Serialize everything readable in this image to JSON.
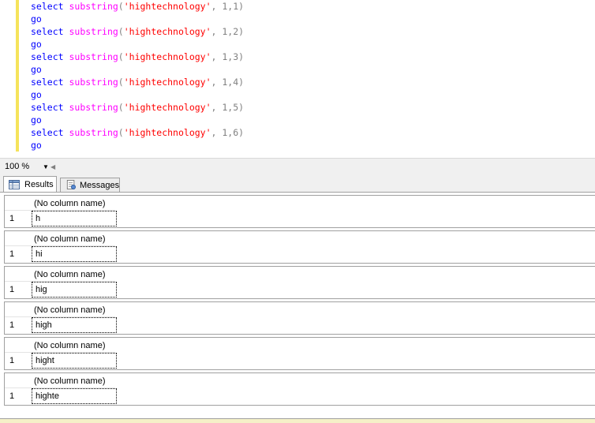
{
  "editor": {
    "lines": [
      {
        "kw": "select",
        "fn": "substring",
        "open": "(",
        "str": "'hightechnology'",
        "args": ", 1,1",
        "close": ")"
      },
      {
        "go": "go"
      },
      {
        "kw": "select",
        "fn": "substring",
        "open": "(",
        "str": "'hightechnology'",
        "args": ", 1,2",
        "close": ")"
      },
      {
        "go": "go"
      },
      {
        "kw": "select",
        "fn": "substring",
        "open": "(",
        "str": "'hightechnology'",
        "args": ", 1,3",
        "close": ")"
      },
      {
        "go": "go"
      },
      {
        "kw": "select",
        "fn": "substring",
        "open": "(",
        "str": "'hightechnology'",
        "args": ", 1,4",
        "close": ")"
      },
      {
        "go": "go"
      },
      {
        "kw": "select",
        "fn": "substring",
        "open": "(",
        "str": "'hightechnology'",
        "args": ", 1,5",
        "close": ")"
      },
      {
        "go": "go"
      },
      {
        "kw": "select",
        "fn": "substring",
        "open": "(",
        "str": "'hightechnology'",
        "args": ", 1,6",
        "close": ")"
      },
      {
        "go": "go"
      }
    ],
    "colors": {
      "keyword": "#0000ff",
      "function": "#ff00ff",
      "string": "#ff0000",
      "change_bar": "#f5e35b"
    }
  },
  "zoom": {
    "value": "100 %",
    "dropdown_icon": "chevron-down-icon",
    "scroll_icon": "chevron-left-icon"
  },
  "tabs": {
    "results": {
      "label": "Results",
      "icon": "grid-icon"
    },
    "messages": {
      "label": "Messages",
      "icon": "messages-icon"
    }
  },
  "results": [
    {
      "header": "(No column name)",
      "row": "1",
      "value": "h"
    },
    {
      "header": "(No column name)",
      "row": "1",
      "value": "hi"
    },
    {
      "header": "(No column name)",
      "row": "1",
      "value": "hig"
    },
    {
      "header": "(No column name)",
      "row": "1",
      "value": "high"
    },
    {
      "header": "(No column name)",
      "row": "1",
      "value": "hight"
    },
    {
      "header": "(No column name)",
      "row": "1",
      "value": "highte"
    }
  ]
}
